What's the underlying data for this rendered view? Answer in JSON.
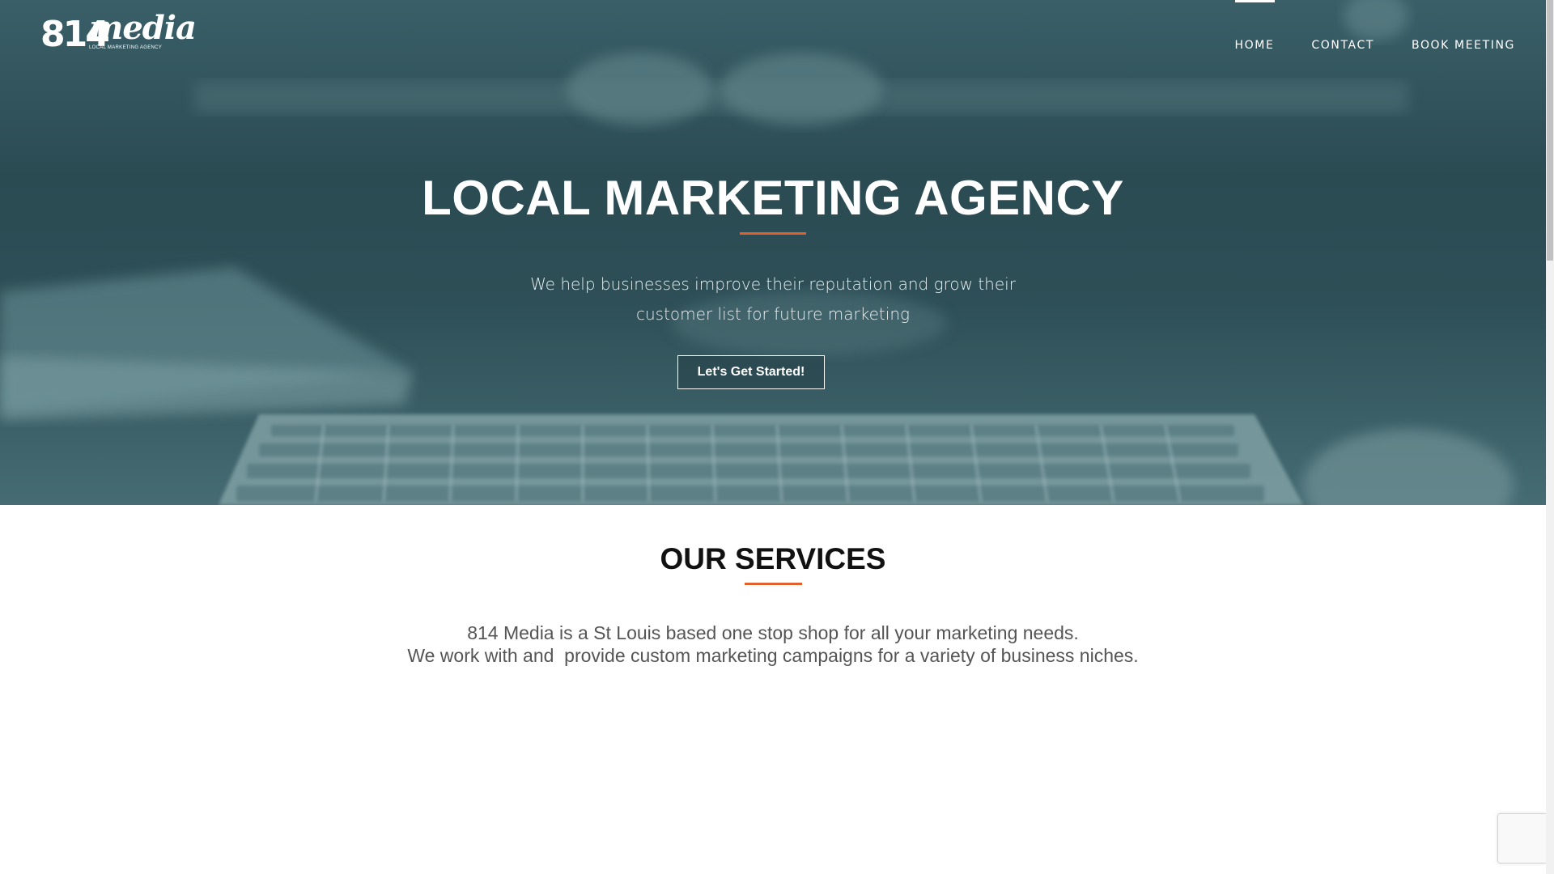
{
  "header": {
    "logo": {
      "numbers": "814",
      "word": "media",
      "tagline": "LOCAL MARKETING AGENCY"
    },
    "nav": [
      {
        "label": "HOME",
        "active": true
      },
      {
        "label": "CONTACT",
        "active": false
      },
      {
        "label": "BOOK MEETING",
        "active": false
      }
    ]
  },
  "hero": {
    "title": "LOCAL MARKETING AGENCY",
    "subtitle_line1": "We help businesses improve their reputation and grow their",
    "subtitle_line2": "customer list for future marketing",
    "cta_label": "Let's Get Started!"
  },
  "services": {
    "title": "OUR SERVICES",
    "line1": "814 Media is a St Louis based one stop shop for all your marketing needs.",
    "line2": "We work with and  provide custom marketing campaigns for a variety of business niches."
  },
  "colors": {
    "accent": "#e0602e",
    "hero_overlay": "#2e4f57",
    "text_dark": "#111111",
    "text_body": "#555555"
  }
}
